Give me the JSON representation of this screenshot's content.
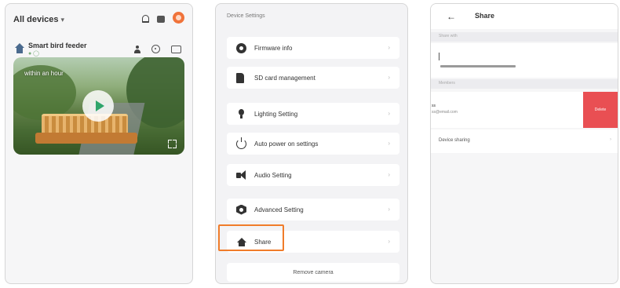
{
  "panel1": {
    "title": "All devices",
    "title_chevron": "▾",
    "device": {
      "name": "Smart bird feeder",
      "status": "● ◯"
    },
    "video": {
      "overlay_text": "within an hour"
    }
  },
  "panel2": {
    "header": "Device Settings",
    "menu": [
      {
        "label": "Firmware info",
        "icon": "gear-icon"
      },
      {
        "label": "SD card management",
        "icon": "sd-card-icon"
      },
      {
        "label": "Lighting Setting",
        "icon": "bulb-icon"
      },
      {
        "label": "Auto power on settings",
        "icon": "power-icon"
      },
      {
        "label": "Audio Setting",
        "icon": "speaker-icon"
      },
      {
        "label": "Advanced Setting",
        "icon": "advanced-gear-icon"
      },
      {
        "label": "Share",
        "icon": "home-share-icon"
      }
    ],
    "arrow": "›",
    "remove_label": "Remove camera",
    "highlight_color": "#f07c2a"
  },
  "panel3": {
    "back": "←",
    "title": "Share",
    "section1_label": "Share with",
    "section2_label": "Members",
    "user_name": "ss",
    "user_account": "ss@email.com",
    "delete_label": "Delete",
    "delete_color": "#e94f53",
    "device_sharing_label": "Device sharing",
    "arrow": "›"
  }
}
